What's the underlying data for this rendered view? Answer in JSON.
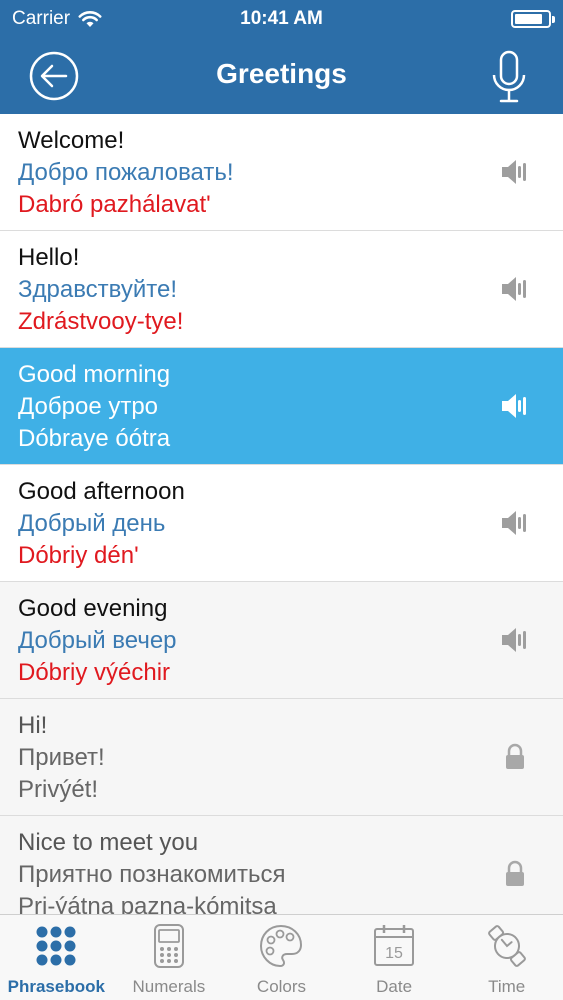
{
  "status_bar": {
    "carrier": "Carrier",
    "time": "10:41 AM",
    "battery_level": 0.85
  },
  "nav": {
    "title": "Greetings",
    "back_icon": "back-arrow-icon",
    "mic_icon": "microphone-icon"
  },
  "phrases": [
    {
      "en": "Welcome!",
      "ru": "Добро пожаловать!",
      "tr": "Dabró pazhálavat'",
      "state": "normal",
      "icon": "speaker-icon"
    },
    {
      "en": "Hello!",
      "ru": "Здравствуйте!",
      "tr": "Zdrástvooy-tye!",
      "state": "normal",
      "icon": "speaker-icon"
    },
    {
      "en": "Good morning",
      "ru": "Доброе утро",
      "tr": "Dóbraye óótra",
      "state": "selected",
      "icon": "speaker-icon"
    },
    {
      "en": "Good afternoon",
      "ru": "Добрый день",
      "tr": "Dóbriy dén'",
      "state": "normal",
      "icon": "speaker-icon"
    },
    {
      "en": "Good evening",
      "ru": "Добрый вечер",
      "tr": "Dóbriy výéchir",
      "state": "normal",
      "icon": "speaker-icon"
    },
    {
      "en": "Hi!",
      "ru": "Привет!",
      "tr": "Privýét!",
      "state": "locked",
      "icon": "lock-icon"
    },
    {
      "en": "Nice to meet you",
      "ru": "Приятно познакомиться",
      "tr": "Pri-ýátna pazna-kómitsa",
      "state": "locked",
      "icon": "lock-icon"
    }
  ],
  "tabs": [
    {
      "label": "Phrasebook",
      "icon": "grid-dots-icon",
      "active": true
    },
    {
      "label": "Numerals",
      "icon": "calculator-icon",
      "active": false
    },
    {
      "label": "Colors",
      "icon": "palette-icon",
      "active": false
    },
    {
      "label": "Date",
      "icon": "calendar-icon",
      "active": false,
      "icon_text": "15"
    },
    {
      "label": "Time",
      "icon": "watch-icon",
      "active": false
    }
  ],
  "colors": {
    "header": "#2c6ea8",
    "selected_row": "#3fb0e6",
    "russian_text": "#3b7bb3",
    "transliteration_text": "#e0191f"
  }
}
